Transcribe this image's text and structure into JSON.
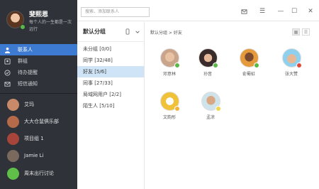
{
  "profile": {
    "name": "斐熙恩",
    "motto": "每个人的一生都是一次远行",
    "status_color": "#5ab946"
  },
  "nav": [
    {
      "label": "联系人",
      "icon": "person-icon",
      "active": true
    },
    {
      "label": "群组",
      "icon": "group-icon",
      "active": false
    },
    {
      "label": "待办提醒",
      "icon": "check-circle-icon",
      "active": false
    },
    {
      "label": "短信通知",
      "icon": "message-icon",
      "active": false
    }
  ],
  "sessions": [
    {
      "label": "艾玛",
      "color": "#c98a6a"
    },
    {
      "label": "大大仓鼠俱乐部",
      "color": "#b56a4a"
    },
    {
      "label": "项目组 1",
      "color": "#a7453a"
    },
    {
      "label": "Jamie Li",
      "color": "#7a6a5e"
    },
    {
      "label": "周末出行讨论",
      "color": "#5fbf48"
    }
  ],
  "topbar": {
    "search_placeholder": "搜索、添加联系人",
    "icons": [
      "mail-icon",
      "menu-icon",
      "minimize-icon",
      "maximize-icon",
      "close-icon"
    ],
    "glyphs": {
      "menu": "☰",
      "minimize": "—",
      "maximize": "☐",
      "close": "✕"
    }
  },
  "groups": {
    "header": "默认分组",
    "items": [
      {
        "label": "未分组 [0/0]",
        "active": false
      },
      {
        "label": "同学 [32/48]",
        "active": false
      },
      {
        "label": "好友 [5/6]",
        "active": true
      },
      {
        "label": "同事 [27/33]",
        "active": false
      },
      {
        "label": "局域网用户 [2/2]",
        "active": false
      },
      {
        "label": "陌生人 [5/10]",
        "active": false
      }
    ]
  },
  "main": {
    "breadcrumb": "默认分组 > 好友",
    "contacts": [
      {
        "name": "邓意林",
        "badge_color": "#5ab946",
        "bg": "#c9a58c"
      },
      {
        "name": "孙音",
        "badge_color": "#5ab946",
        "bg": "#3a2c2a"
      },
      {
        "name": "俞蜀虹",
        "badge_color": "#5ab946",
        "bg": "#e59a3c"
      },
      {
        "name": "张大赞",
        "badge_color": "#e04a3a",
        "bg": "#8fd0ef"
      },
      {
        "name": "文韵彤",
        "badge_color": "#f2b43a",
        "bg": "#f0c23a"
      },
      {
        "name": "孟凉",
        "badge_color": "#f2d64a",
        "bg": "#cfe3ea"
      }
    ]
  }
}
